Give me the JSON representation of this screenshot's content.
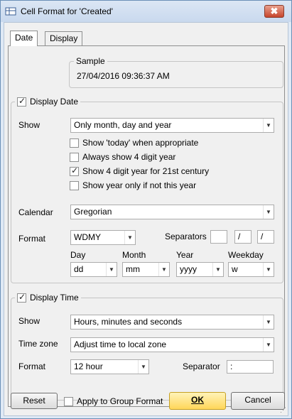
{
  "window": {
    "title": "Cell Format for 'Created'",
    "close_glyph": "✖"
  },
  "tabs": [
    {
      "label": "Date"
    },
    {
      "label": "Display"
    }
  ],
  "sample": {
    "legend": "Sample",
    "value": "27/04/2016 09:36:37 AM"
  },
  "date_group": {
    "legend": "Display Date",
    "show_label": "Show",
    "show_value": "Only month, day and year",
    "options": [
      {
        "label": "Show 'today' when appropriate",
        "checked": false
      },
      {
        "label": "Always show 4 digit year",
        "checked": false
      },
      {
        "label": "Show 4 digit year for 21st century",
        "checked": true
      },
      {
        "label": "Show year only if not this year",
        "checked": false
      }
    ],
    "calendar_label": "Calendar",
    "calendar_value": "Gregorian",
    "format_label": "Format",
    "format_value": "WDMY",
    "separators_label": "Separators",
    "separators": [
      "",
      "/",
      "/"
    ],
    "parts": [
      {
        "label": "Day",
        "value": "dd"
      },
      {
        "label": "Month",
        "value": "mm"
      },
      {
        "label": "Year",
        "value": "yyyy"
      },
      {
        "label": "Weekday",
        "value": "w"
      }
    ]
  },
  "time_group": {
    "legend": "Display Time",
    "show_label": "Show",
    "show_value": "Hours, minutes and seconds",
    "timezone_label": "Time zone",
    "timezone_value": "Adjust time to local zone",
    "format_label": "Format",
    "format_value": "12 hour",
    "separator_label": "Separator",
    "separator_value": ":"
  },
  "footer": {
    "reset": "Reset",
    "apply_group": "Apply to Group Format",
    "ok": "OK",
    "cancel": "Cancel"
  },
  "colors": {
    "ok_button": "#ffd65a",
    "close_button": "#c7452c",
    "title_bar": "#c9d9ee"
  }
}
